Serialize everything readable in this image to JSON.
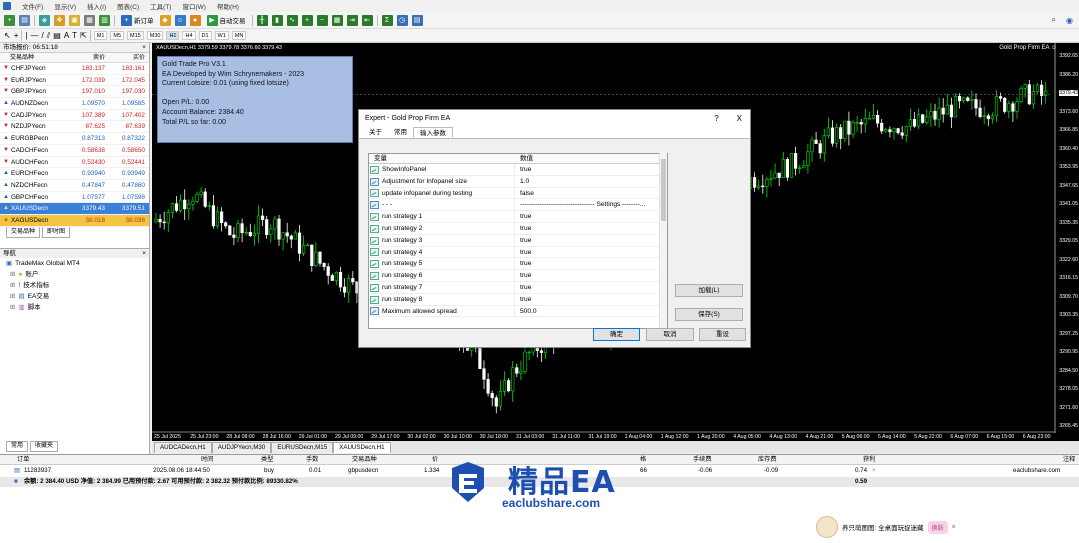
{
  "menu": [
    "文件(F)",
    "显示(V)",
    "插入(I)",
    "图表(C)",
    "工具(T)",
    "窗口(W)",
    "帮助(H)"
  ],
  "toolbar": {
    "new_order": "新订单",
    "auto_trading": "自动交易",
    "timeframes": [
      "M1",
      "M5",
      "M15",
      "M30",
      "H1",
      "H4",
      "D1",
      "W1",
      "MN"
    ],
    "active_timeframe": "H1"
  },
  "market_watch": {
    "title": "市场报价: 06:51:18",
    "col_symbol": "交易品种",
    "col_bid": "卖价",
    "col_ask": "买价",
    "rows": [
      {
        "symbol": "CHFJPYecn",
        "bid": "183.137",
        "ask": "183.161",
        "dir": "down"
      },
      {
        "symbol": "EURJPYecn",
        "bid": "172.039",
        "ask": "172.045",
        "dir": "down"
      },
      {
        "symbol": "GBPJPYecn",
        "bid": "197.010",
        "ask": "197.030",
        "dir": "down"
      },
      {
        "symbol": "AUDNZDecn",
        "bid": "1.09570",
        "ask": "1.09585",
        "dir": "up"
      },
      {
        "symbol": "CADJPYecn",
        "bid": "107.389",
        "ask": "107.402",
        "dir": "down"
      },
      {
        "symbol": "NZDJPYecn",
        "bid": "87.625",
        "ask": "87.639",
        "dir": "down"
      },
      {
        "symbol": "EURGBPecn",
        "bid": "0.87313",
        "ask": "0.87322",
        "dir": "up"
      },
      {
        "symbol": "CADCHFecn",
        "bid": "0.58638",
        "ask": "0.58650",
        "dir": "down"
      },
      {
        "symbol": "AUDCHFecn",
        "bid": "0.52430",
        "ask": "0.52441",
        "dir": "down"
      },
      {
        "symbol": "EURCHFecn",
        "bid": "0.93940",
        "ask": "0.93949",
        "dir": "up"
      },
      {
        "symbol": "NZDCHFecn",
        "bid": "0.47847",
        "ask": "0.47860",
        "dir": "up"
      },
      {
        "symbol": "GBPCHFecn",
        "bid": "1.07577",
        "ask": "1.07598",
        "dir": "up"
      },
      {
        "symbol": "XAUUSDecn",
        "bid": "3379.43",
        "ask": "3379.51",
        "dir": "up"
      },
      {
        "symbol": "XAGUSDecn",
        "bid": "38.018",
        "ask": "38.036",
        "dir": "up"
      }
    ],
    "tabs": [
      "交易品种",
      "即时图"
    ]
  },
  "navigator": {
    "title": "导航",
    "root": "TradeMax Global MT4",
    "items": [
      "账户",
      "技术指标",
      "EA交易",
      "脚本"
    ],
    "tabs": [
      "常用",
      "收藏夹"
    ]
  },
  "chart": {
    "title": "XAUUSDecn,H1  3379.59 3379.78 3376.60 3379.43",
    "ea_label": "Gold Prop Firm EA ☺",
    "price_labels": [
      "3392.65",
      "3386.20",
      "3379.43",
      "3373.60",
      "3366.85",
      "3360.40",
      "3353.95",
      "3347.65",
      "3341.05",
      "3335.35",
      "3329.05",
      "3322.60",
      "3316.15",
      "3309.70",
      "3303.35",
      "3297.25",
      "3290.95",
      "3284.50",
      "3278.05",
      "3271.60",
      "3265.45"
    ],
    "current_price": "3379.43",
    "time_labels": [
      "25 Jul 2025",
      "25 Jul 23:00",
      "28 Jul 08:00",
      "28 Jul 16:00",
      "29 Jul 01:00",
      "29 Jul 09:00",
      "29 Jul 17:00",
      "30 Jul 02:00",
      "30 Jul 10:00",
      "30 Jul 18:00",
      "31 Jul 03:00",
      "31 Jul 11:00",
      "31 Jul 19:00",
      "1 Aug 04:00",
      "1 Aug 12:00",
      "1 Aug 20:00",
      "4 Aug 05:00",
      "4 Aug 13:00",
      "4 Aug 21:00",
      "5 Aug 06:00",
      "5 Aug 14:00",
      "5 Aug 22:00",
      "6 Aug 07:00",
      "6 Aug 15:00",
      "6 Aug 23:00"
    ]
  },
  "infopanel": {
    "lines": [
      "Gold Trade Pro V3.1",
      "EA Developed by Wim Schrynemakers - 2023",
      "Current Lotsize: 0.01 (using fixed lotsize)",
      "",
      "Open P/L: 0.00",
      "Account Balance: 2384.40",
      "Total P/L so far: 0.00"
    ]
  },
  "chart_tabs": [
    "AUDCADecn,H1",
    "AUDJPYecn,M30",
    "EURUSDecn,M15",
    "XAUUSDecn,H1"
  ],
  "dialog": {
    "title": "Expert - Gold Prop Firm EA",
    "help": "?",
    "close": "X",
    "tabs": [
      "关于",
      "常用",
      "输入参数"
    ],
    "col_variable": "变量",
    "col_value": "数值",
    "params": [
      {
        "name": "ShowInfoPanel",
        "value": "true",
        "icon": "green"
      },
      {
        "name": "Adjustment for Infopanel size",
        "value": "1.0",
        "icon": "blue"
      },
      {
        "name": "update infopanel during testing",
        "value": "false",
        "icon": "green"
      },
      {
        "name": "- - -",
        "value": "---------------------------------- Settings --------...",
        "icon": "blue"
      },
      {
        "name": "run strategy 1",
        "value": "true",
        "icon": "green"
      },
      {
        "name": "run strategy 2",
        "value": "true",
        "icon": "green"
      },
      {
        "name": "run strategy 3",
        "value": "true",
        "icon": "green"
      },
      {
        "name": "run strategy 4",
        "value": "true",
        "icon": "green"
      },
      {
        "name": "run strategy 5",
        "value": "true",
        "icon": "green"
      },
      {
        "name": "run strategy 6",
        "value": "true",
        "icon": "green"
      },
      {
        "name": "run strategy 7",
        "value": "true",
        "icon": "green"
      },
      {
        "name": "run strategy 8",
        "value": "true",
        "icon": "green"
      },
      {
        "name": "Maximum allowed spread",
        "value": "500.0",
        "icon": "blue"
      }
    ],
    "btn_load": "加载(L)",
    "btn_save": "保存(S)",
    "btn_ok": "确定",
    "btn_cancel": "取消",
    "btn_reset": "重设"
  },
  "terminal": {
    "headers": {
      "order": "订单",
      "time": "时间",
      "type": "类型",
      "lots": "手数",
      "symbol": "交易品种",
      "price": "价",
      "tp": "格",
      "commission": "手续费",
      "swap": "库存费",
      "profit": "获利",
      "comment": "注释"
    },
    "row": {
      "order": "11283937",
      "time": "2025.08.06 18:44:50",
      "type": "buy",
      "lots": "0.01",
      "symbol": "gbpusdecn",
      "price": "1.334",
      "tp": "66",
      "commission": "-0.06",
      "swap": "-0.09",
      "profit": "0.74",
      "comment": "eaclubshare.com"
    },
    "summary": "余额: 2 384.40 USD  净值: 2 384.99  已用预付款: 2.67  可用预付款: 2 382.32  预付款比例: 89330.82%",
    "summary_profit": "0.59"
  },
  "watermark": {
    "title": "精品EA",
    "url": "eaclubshare.com"
  },
  "promo": {
    "text": "养只萌图图: 全桌面玩捉迷藏",
    "button": "换肤"
  },
  "colors": {
    "bull": "#00e000",
    "bear": "#ffffff",
    "panel": "#a8bfe3",
    "selected": "#3a7fd8",
    "brand": "#1d4fb1"
  }
}
